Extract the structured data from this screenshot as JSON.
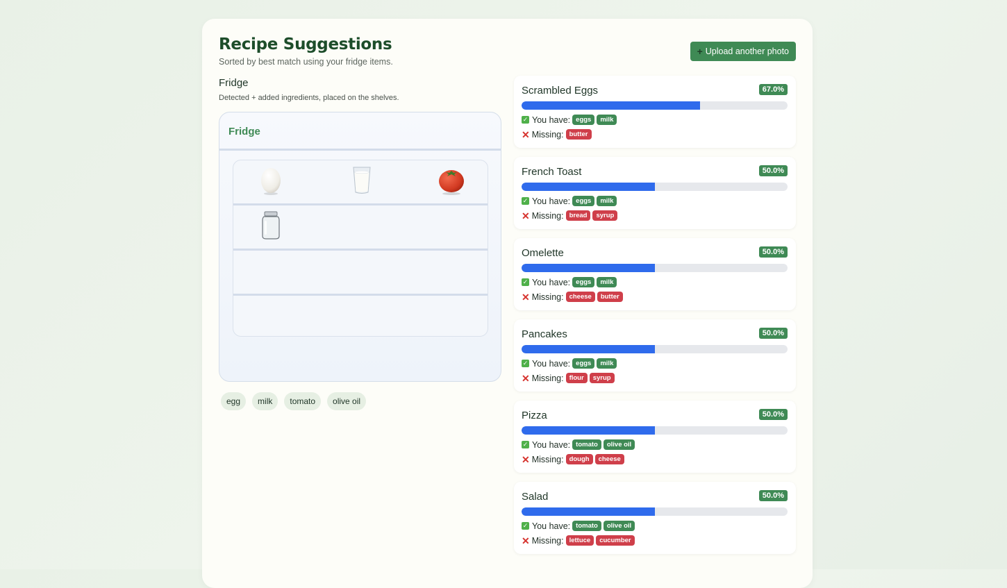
{
  "header": {
    "title": "Recipe Suggestions",
    "subtitle": "Sorted by best match using your fridge items.",
    "upload_label": "Upload another photo"
  },
  "fridge": {
    "heading": "Fridge",
    "description": "Detected + added ingredients, placed on the shelves.",
    "box_title": "Fridge",
    "shelf_items": [
      [
        "egg-icon",
        "milk-glass-icon",
        "tomato-icon"
      ],
      [
        "jar-icon"
      ],
      [],
      []
    ]
  },
  "ingredients": [
    "egg",
    "milk",
    "tomato",
    "olive oil"
  ],
  "labels": {
    "have": "You have:",
    "missing": "Missing:"
  },
  "recipes": [
    {
      "name": "Scrambled Eggs",
      "percent_label": "67.0%",
      "match": 0.67,
      "have": [
        "eggs",
        "milk"
      ],
      "missing": [
        "butter"
      ]
    },
    {
      "name": "French Toast",
      "percent_label": "50.0%",
      "match": 0.5,
      "have": [
        "eggs",
        "milk"
      ],
      "missing": [
        "bread",
        "syrup"
      ]
    },
    {
      "name": "Omelette",
      "percent_label": "50.0%",
      "match": 0.5,
      "have": [
        "eggs",
        "milk"
      ],
      "missing": [
        "cheese",
        "butter"
      ]
    },
    {
      "name": "Pancakes",
      "percent_label": "50.0%",
      "match": 0.5,
      "have": [
        "eggs",
        "milk"
      ],
      "missing": [
        "flour",
        "syrup"
      ]
    },
    {
      "name": "Pizza",
      "percent_label": "50.0%",
      "match": 0.5,
      "have": [
        "tomato",
        "olive oil"
      ],
      "missing": [
        "dough",
        "cheese"
      ]
    },
    {
      "name": "Salad",
      "percent_label": "50.0%",
      "match": 0.5,
      "have": [
        "tomato",
        "olive oil"
      ],
      "missing": [
        "lettuce",
        "cucumber"
      ]
    }
  ],
  "colors": {
    "accent": "#3f8a55",
    "bar": "#2f6bec",
    "missing": "#cf3f4a"
  }
}
